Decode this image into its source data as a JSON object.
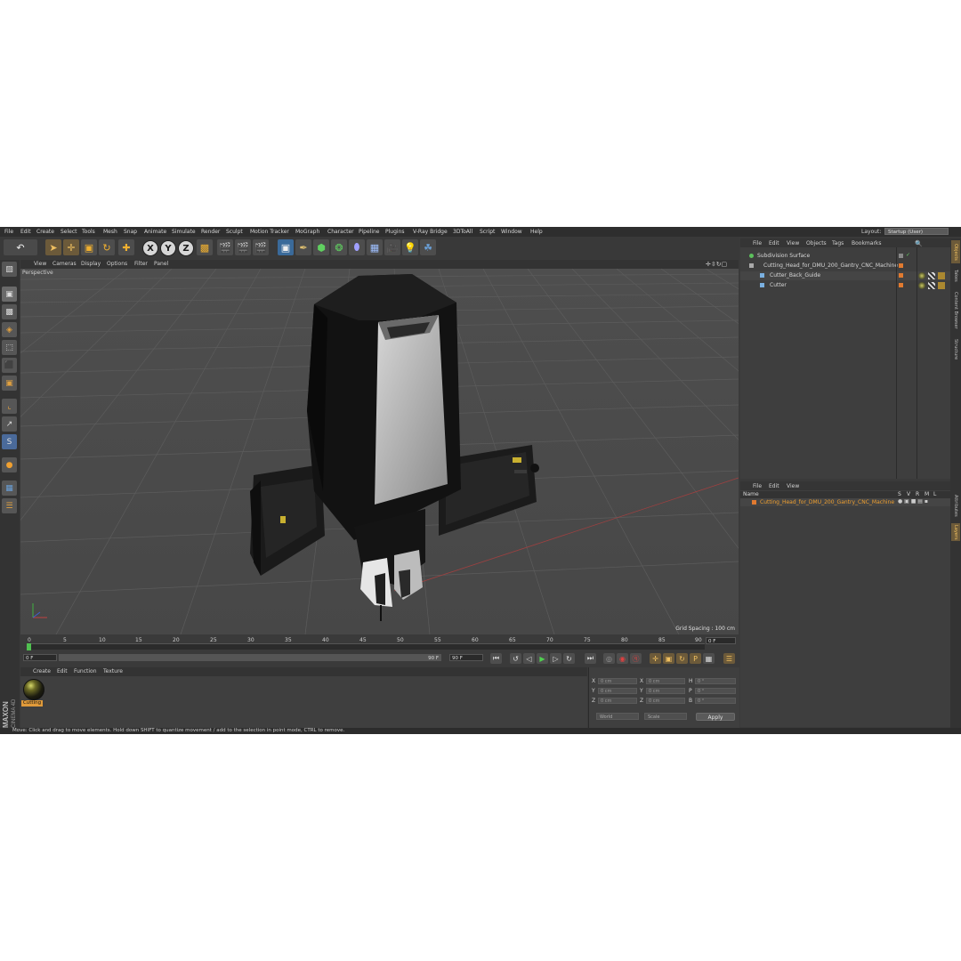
{
  "menubar": {
    "items": [
      "File",
      "Edit",
      "Create",
      "Select",
      "Tools",
      "Mesh",
      "Snap",
      "Animate",
      "Simulate",
      "Render",
      "Sculpt",
      "Motion Tracker",
      "MoGraph",
      "Character",
      "Pipeline",
      "Plugins",
      "V-Ray Bridge",
      "3DToAll",
      "Script",
      "Window",
      "Help"
    ],
    "layout_label": "Layout:",
    "layout_value": "Startup (User)"
  },
  "toolbar": {
    "axis_x": "X",
    "axis_y": "Y",
    "axis_z": "Z"
  },
  "viewport": {
    "menu": [
      "View",
      "Cameras",
      "Display",
      "Options",
      "Filter",
      "Panel"
    ],
    "camera_label": "Perspective",
    "grid_spacing": "Grid Spacing : 100 cm"
  },
  "timeline": {
    "ticks": [
      "0",
      "5",
      "10",
      "15",
      "20",
      "25",
      "30",
      "35",
      "40",
      "45",
      "50",
      "55",
      "60",
      "65",
      "70",
      "75",
      "80",
      "85",
      "90"
    ],
    "current_frame": "0 F",
    "start_frame": "0 F",
    "range_end": "90 F",
    "end_frame": "90 F"
  },
  "material_manager": {
    "menu": [
      "Create",
      "Edit",
      "Function",
      "Texture"
    ],
    "material_name": "Cutting"
  },
  "coordinates": {
    "row_labels_1": [
      "X",
      "Y",
      "Z"
    ],
    "row_labels_2": [
      "X",
      "Y",
      "Z"
    ],
    "row_labels_3": [
      "H",
      "P",
      "B"
    ],
    "pos_values": [
      "0 cm",
      "0 cm",
      "0 cm"
    ],
    "size_values": [
      "0 cm",
      "0 cm",
      "0 cm"
    ],
    "rot_values": [
      "0 °",
      "0 °",
      "0 °"
    ],
    "mode_dropdown": "World",
    "size_dropdown": "Scale",
    "apply_label": "Apply"
  },
  "status": {
    "text": "Move: Click and drag to move elements. Hold down SHIFT to quantize movement / add to the selection in point mode, CTRL to remove."
  },
  "object_manager": {
    "menu": [
      "File",
      "Edit",
      "View",
      "Objects",
      "Tags",
      "Bookmarks"
    ],
    "objects": [
      {
        "name": "Subdivision Surface"
      },
      {
        "name": "Cutting_Head_for_DMU_200_Gantry_CNC_Machine"
      },
      {
        "name": "Cutter_Back_Guide"
      },
      {
        "name": "Cutter"
      }
    ]
  },
  "layer_manager": {
    "menu": [
      "File",
      "Edit",
      "View"
    ],
    "header_name": "Name",
    "header_cols": [
      "S",
      "V",
      "R",
      "M",
      "L"
    ],
    "row_name": "Cutting_Head_for_DMU_200_Gantry_CNC_Machine"
  },
  "right_tabs": [
    "Objects",
    "Takes",
    "Content Browser",
    "Structure",
    "Attributes",
    "Layers"
  ],
  "colors": {
    "accent_orange": "#e09a3a",
    "selected_text": "#f0a030",
    "viewport_bg": "#4b4b4b",
    "grid_line": "#5a5a5a"
  }
}
